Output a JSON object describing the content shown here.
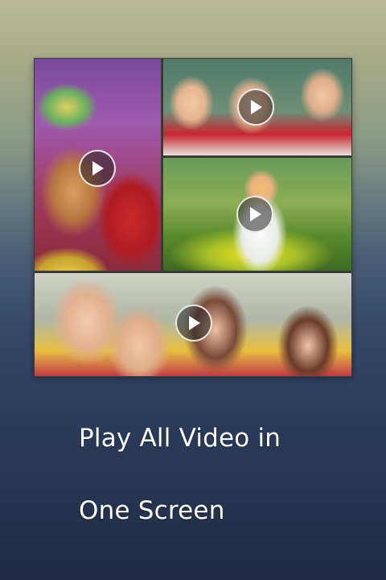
{
  "collage": {
    "tiles": [
      {
        "name": "holi-children-video",
        "action": "play"
      },
      {
        "name": "school-children-video",
        "action": "play"
      },
      {
        "name": "girl-in-flower-field-video",
        "action": "play"
      },
      {
        "name": "group-of-girls-video",
        "action": "play"
      }
    ]
  },
  "caption": {
    "line1": "Play All Video in",
    "line2": "One Screen"
  },
  "icons": {
    "play": "play-icon"
  },
  "colors": {
    "caption_text": "#ffffff",
    "play_button_border": "#ffffff"
  }
}
